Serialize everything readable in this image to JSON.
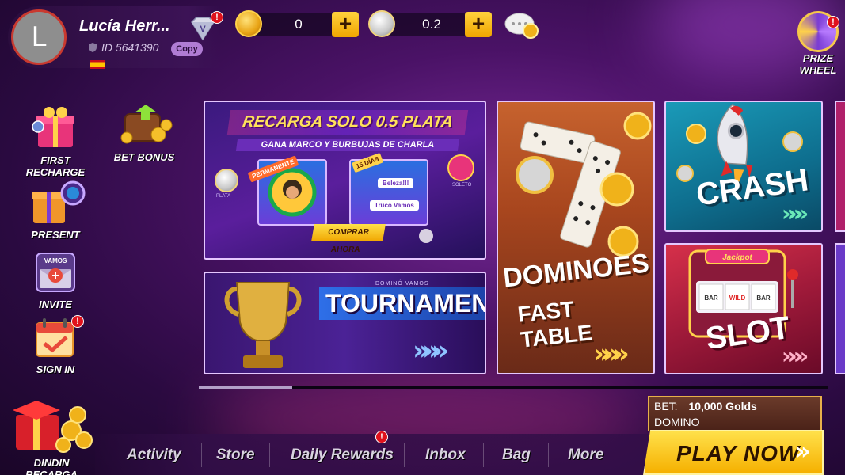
{
  "profile": {
    "avatar_letter": "L",
    "name": "Lucía Herr...",
    "id_text": "ID 5641390",
    "copy_label": "Copy",
    "vip_letter": "V",
    "vip_badge": "!"
  },
  "currency": {
    "gold": "0",
    "silver": "0.2",
    "add_label": "+"
  },
  "prize_wheel": {
    "label_line1": "PRIZE",
    "label_line2": "WHEEL",
    "badge": "!"
  },
  "left_menu": {
    "first_recharge": {
      "line1": "FIRST",
      "line2": "RECHARGE"
    },
    "bet_bonus": "BET BONUS",
    "present": "PRESENT",
    "invite": "INVITE",
    "invite_sign": "VAMOS",
    "sign_in": "SIGN IN",
    "sign_in_badge": "!"
  },
  "promo": {
    "title": "RECARGA SOLO 0.5 PLATA",
    "subtitle": "GANA MARCO Y BURBUJAS DE CHARLA",
    "tag_left": "PERMANENTE",
    "tag_right": "15 DÍAS",
    "chip1": "Beleza!!!",
    "chip2": "Truco Vamos",
    "label_plata": "PLATA",
    "label_soleto": "SOLETO",
    "buy": "COMPRAR AHORA"
  },
  "tournament": {
    "brand": "DOMINÓ VAMOS",
    "title": "TOURNAMENT",
    "arrows": "»»»"
  },
  "dominoes": {
    "title": "DOMINOES",
    "subtitle": "FAST TABLE",
    "arrows": "»»»"
  },
  "crash": {
    "title": "CRASH",
    "arrows": "»»»"
  },
  "slot": {
    "title": "SLOT",
    "sign": "Jackpot",
    "reel1": "BAR",
    "reel2": "WILD",
    "reel3": "BAR",
    "arrows": "»»»"
  },
  "bottom_nav": {
    "dindin_line1": "DINDIN",
    "dindin_line2": "RECARGA",
    "items": [
      "Activity",
      "Store",
      "Daily Rewards",
      "Inbox",
      "Bag",
      "More"
    ],
    "daily_badge": "!"
  },
  "bet": {
    "label": "BET:",
    "amount": "10,000 Golds",
    "game": "DOMINO"
  },
  "play_now": {
    "label": "PLAY NOW",
    "arrows": "»"
  },
  "colors": {
    "accent_gold": "#f5b000",
    "badge_red": "#e0121c",
    "bg_purple": "#4a1266"
  }
}
